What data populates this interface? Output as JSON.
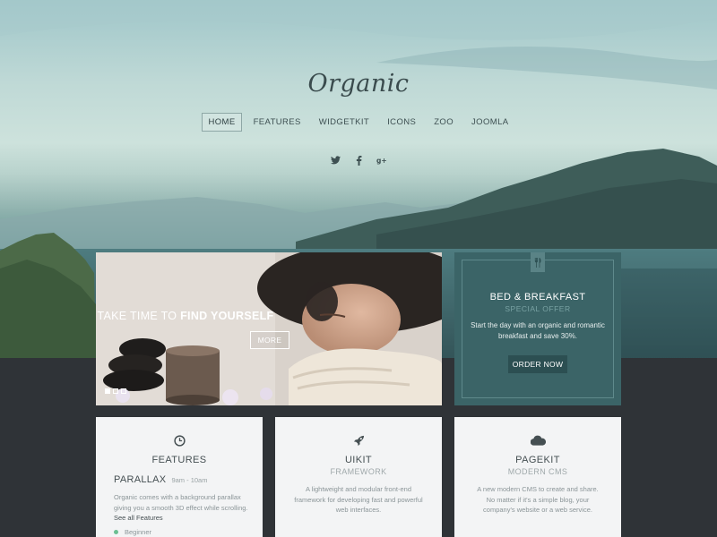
{
  "brand": {
    "logo": "Organic"
  },
  "nav": {
    "items": [
      "HOME",
      "FEATURES",
      "WIDGETKIT",
      "ICONS",
      "ZOO",
      "JOOMLA"
    ],
    "active_index": 0
  },
  "social": {
    "icons": [
      "twitter-icon",
      "facebook-icon",
      "google-plus-icon"
    ]
  },
  "slider": {
    "heading_part1": "TAKE TIME TO",
    "heading_part2": "FIND YOURSELF",
    "button_label": "MORE",
    "slides_count": 3,
    "active_slide": 0
  },
  "offer": {
    "icon": "utensils-icon",
    "title": "BED & BREAKFAST",
    "subtitle": "SPECIAL OFFER",
    "description": "Start the day with an organic and romantic breakfast and save 30%.",
    "button_label": "ORDER NOW"
  },
  "cards": [
    {
      "icon": "clock-icon",
      "title": "FEATURES",
      "item_title": "PARALLAX",
      "item_time": "9am - 10am",
      "item_description": "Organic comes with a background parallax giving you a smooth 3D effect while scrolling.",
      "item_link": "See all Features",
      "level_label": "Beginner",
      "level_color": "#6bbf92"
    },
    {
      "icon": "rocket-icon",
      "title": "UIKIT",
      "subtitle": "FRAMEWORK",
      "description": "A lightweight and modular front-end framework for developing fast and powerful web interfaces."
    },
    {
      "icon": "cloud-icon",
      "title": "PAGEKIT",
      "subtitle": "MODERN CMS",
      "description": "A new modern CMS to create and share. No matter if it's a simple blog, your company's website or a web service."
    }
  ],
  "colors": {
    "accent_teal": "#3b6467",
    "button_dark_teal": "#2c4f52",
    "card_bg": "#f3f4f5",
    "page_dark": "#2f3337"
  }
}
